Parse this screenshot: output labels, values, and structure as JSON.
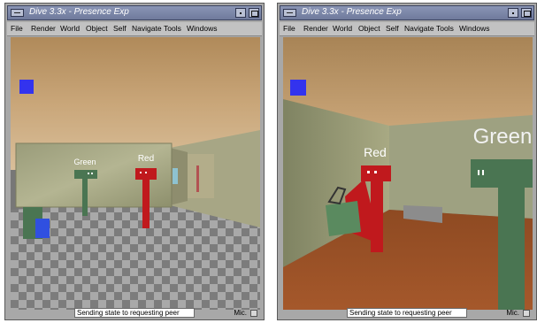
{
  "windows": [
    {
      "title": "Dive 3.3x - Presence Exp",
      "menu": [
        "File",
        "Render",
        "World",
        "Object",
        "Self",
        "Navigate",
        "Tools",
        "Windows"
      ],
      "avatars": {
        "left": "Green",
        "right": "Red"
      },
      "status": "Sending state to requesting peer",
      "mic_label": "Mic."
    },
    {
      "title": "Dive 3.3x - Presence Exp",
      "menu": [
        "File",
        "Render",
        "World",
        "Object",
        "Self",
        "Navigate",
        "Tools",
        "Windows"
      ],
      "avatars": {
        "left": "Red",
        "right": "Green"
      },
      "status": "Sending state to requesting peer",
      "mic_label": "Mic."
    }
  ],
  "colors": {
    "title_bar": "#7a85a6",
    "window_chrome": "#a8a8a8",
    "avatar_red": "#c0191d",
    "avatar_green": "#4a7552",
    "marker_blue": "#3333ee"
  }
}
